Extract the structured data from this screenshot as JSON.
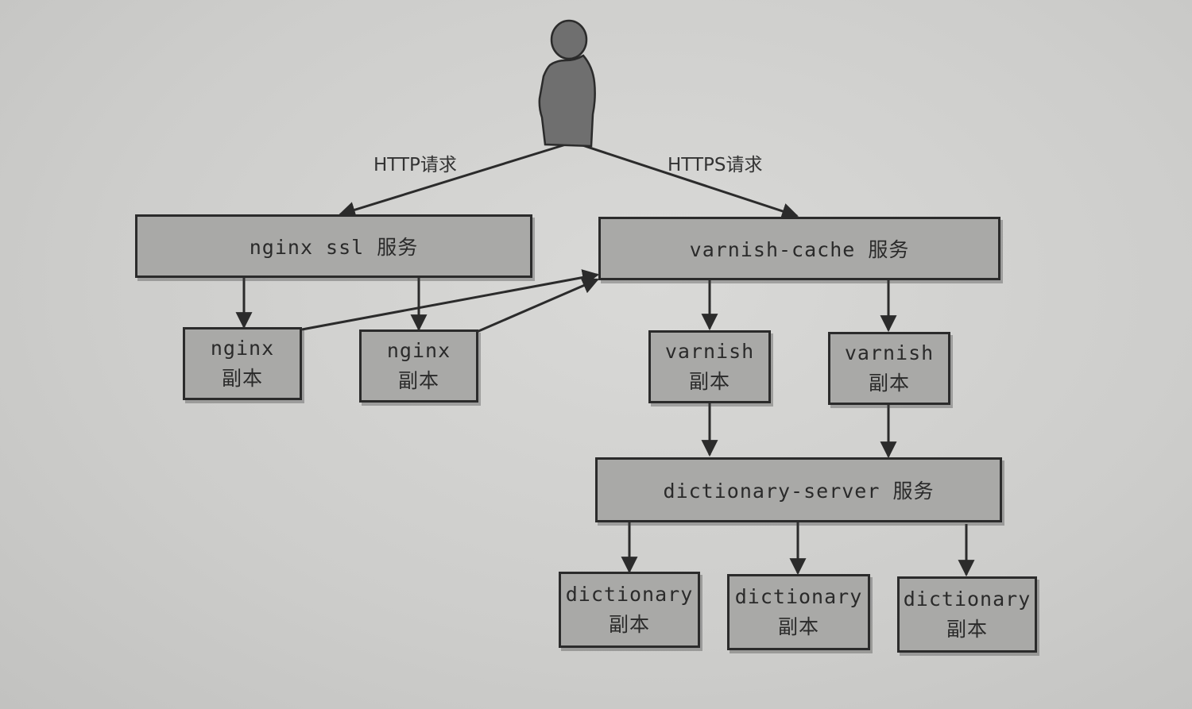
{
  "labels": {
    "http_request": "HTTP请求",
    "https_request": "HTTPS请求"
  },
  "services": {
    "nginx_ssl": "nginx ssl 服务",
    "varnish_cache": "varnish-cache 服务",
    "dictionary_server": "dictionary-server 服务"
  },
  "replicas": {
    "nginx_1": {
      "name": "nginx",
      "suffix": "副本"
    },
    "nginx_2": {
      "name": "nginx",
      "suffix": "副本"
    },
    "varnish_1": {
      "name": "varnish",
      "suffix": "副本"
    },
    "varnish_2": {
      "name": "varnish",
      "suffix": "副本"
    },
    "dictionary_1": {
      "name": "dictionary",
      "suffix": "副本"
    },
    "dictionary_2": {
      "name": "dictionary",
      "suffix": "副本"
    },
    "dictionary_3": {
      "name": "dictionary",
      "suffix": "副本"
    }
  },
  "icons": {
    "user": "person-icon"
  },
  "colors": {
    "box_fill": "#a9a9a7",
    "stroke": "#2b2b2b",
    "user": "#6f6f6f"
  }
}
